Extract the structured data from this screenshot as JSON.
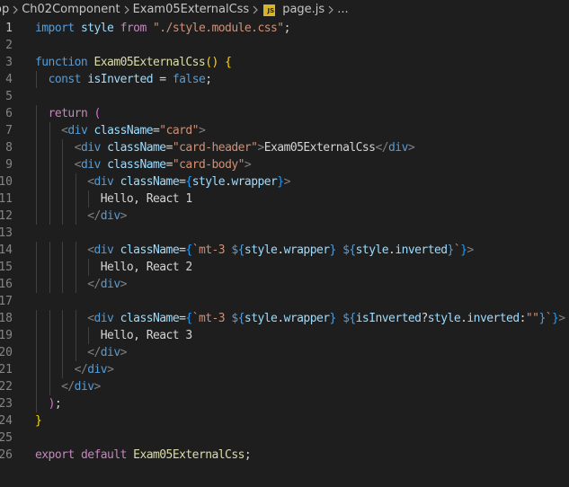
{
  "breadcrumb": {
    "items": [
      "op",
      "Ch02Component",
      "Exam05ExternalCss",
      "page.js",
      "..."
    ],
    "file_icon_label": "JS"
  },
  "editor": {
    "active_line": 1,
    "lines": [
      {
        "n": "1",
        "tokens": [
          [
            "kw",
            "import"
          ],
          [
            "plain",
            " "
          ],
          [
            "var",
            "style"
          ],
          [
            "plain",
            " "
          ],
          [
            "ctl",
            "from"
          ],
          [
            "plain",
            " "
          ],
          [
            "str",
            "\"./style.module.css\""
          ],
          [
            "plain",
            ";"
          ]
        ]
      },
      {
        "n": "2",
        "tokens": []
      },
      {
        "n": "3",
        "tokens": [
          [
            "kw",
            "function"
          ],
          [
            "plain",
            " "
          ],
          [
            "fn",
            "Exam05ExternalCss"
          ],
          [
            "br1",
            "()"
          ],
          [
            "plain",
            " "
          ],
          [
            "br1",
            "{"
          ]
        ]
      },
      {
        "n": "4",
        "tokens": [
          [
            "plain",
            "  "
          ],
          [
            "kw",
            "const"
          ],
          [
            "plain",
            " "
          ],
          [
            "var",
            "isInverted"
          ],
          [
            "plain",
            " = "
          ],
          [
            "kw",
            "false"
          ],
          [
            "plain",
            ";"
          ]
        ]
      },
      {
        "n": "5",
        "tokens": []
      },
      {
        "n": "6",
        "tokens": [
          [
            "plain",
            "  "
          ],
          [
            "ctl",
            "return"
          ],
          [
            "plain",
            " "
          ],
          [
            "br2",
            "("
          ]
        ]
      },
      {
        "n": "7",
        "tokens": [
          [
            "plain",
            "    "
          ],
          [
            "brk",
            "<"
          ],
          [
            "tag",
            "div"
          ],
          [
            "plain",
            " "
          ],
          [
            "var",
            "className"
          ],
          [
            "plain",
            "="
          ],
          [
            "str",
            "\"card\""
          ],
          [
            "brk",
            ">"
          ]
        ]
      },
      {
        "n": "8",
        "tokens": [
          [
            "plain",
            "      "
          ],
          [
            "brk",
            "<"
          ],
          [
            "tag",
            "div"
          ],
          [
            "plain",
            " "
          ],
          [
            "var",
            "className"
          ],
          [
            "plain",
            "="
          ],
          [
            "str",
            "\"card-header\""
          ],
          [
            "brk",
            ">"
          ],
          [
            "plain",
            "Exam05ExternalCss"
          ],
          [
            "brk",
            "</"
          ],
          [
            "tag",
            "div"
          ],
          [
            "brk",
            ">"
          ]
        ]
      },
      {
        "n": "9",
        "tokens": [
          [
            "plain",
            "      "
          ],
          [
            "brk",
            "<"
          ],
          [
            "tag",
            "div"
          ],
          [
            "plain",
            " "
          ],
          [
            "var",
            "className"
          ],
          [
            "plain",
            "="
          ],
          [
            "str",
            "\"card-body\""
          ],
          [
            "brk",
            ">"
          ]
        ]
      },
      {
        "n": "10",
        "tokens": [
          [
            "plain",
            "        "
          ],
          [
            "brk",
            "<"
          ],
          [
            "tag",
            "div"
          ],
          [
            "plain",
            " "
          ],
          [
            "var",
            "className"
          ],
          [
            "plain",
            "="
          ],
          [
            "br3",
            "{"
          ],
          [
            "var",
            "style"
          ],
          [
            "plain",
            "."
          ],
          [
            "var",
            "wrapper"
          ],
          [
            "br3",
            "}"
          ],
          [
            "brk",
            ">"
          ]
        ]
      },
      {
        "n": "11",
        "tokens": [
          [
            "plain",
            "          Hello, React 1"
          ]
        ]
      },
      {
        "n": "12",
        "tokens": [
          [
            "plain",
            "        "
          ],
          [
            "brk",
            "</"
          ],
          [
            "tag",
            "div"
          ],
          [
            "brk",
            ">"
          ]
        ]
      },
      {
        "n": "13",
        "tokens": []
      },
      {
        "n": "14",
        "tokens": [
          [
            "plain",
            "        "
          ],
          [
            "brk",
            "<"
          ],
          [
            "tag",
            "div"
          ],
          [
            "plain",
            " "
          ],
          [
            "var",
            "className"
          ],
          [
            "plain",
            "="
          ],
          [
            "br3",
            "{"
          ],
          [
            "str",
            "`mt-3 "
          ],
          [
            "kw",
            "${"
          ],
          [
            "var",
            "style"
          ],
          [
            "plain",
            "."
          ],
          [
            "var",
            "wrapper"
          ],
          [
            "kw",
            "}"
          ],
          [
            "str",
            " "
          ],
          [
            "kw",
            "${"
          ],
          [
            "var",
            "style"
          ],
          [
            "plain",
            "."
          ],
          [
            "var",
            "inverted"
          ],
          [
            "kw",
            "}"
          ],
          [
            "str",
            "`"
          ],
          [
            "br3",
            "}"
          ],
          [
            "brk",
            ">"
          ]
        ]
      },
      {
        "n": "15",
        "tokens": [
          [
            "plain",
            "          Hello, React 2"
          ]
        ]
      },
      {
        "n": "16",
        "tokens": [
          [
            "plain",
            "        "
          ],
          [
            "brk",
            "</"
          ],
          [
            "tag",
            "div"
          ],
          [
            "brk",
            ">"
          ]
        ]
      },
      {
        "n": "17",
        "tokens": []
      },
      {
        "n": "18",
        "tokens": [
          [
            "plain",
            "        "
          ],
          [
            "brk",
            "<"
          ],
          [
            "tag",
            "div"
          ],
          [
            "plain",
            " "
          ],
          [
            "var",
            "className"
          ],
          [
            "plain",
            "="
          ],
          [
            "br3",
            "{"
          ],
          [
            "str",
            "`mt-3 "
          ],
          [
            "kw",
            "${"
          ],
          [
            "var",
            "style"
          ],
          [
            "plain",
            "."
          ],
          [
            "var",
            "wrapper"
          ],
          [
            "kw",
            "}"
          ],
          [
            "str",
            " "
          ],
          [
            "kw",
            "${"
          ],
          [
            "var",
            "isInverted"
          ],
          [
            "plain",
            "?"
          ],
          [
            "var",
            "style"
          ],
          [
            "plain",
            "."
          ],
          [
            "var",
            "inverted"
          ],
          [
            "plain",
            ":"
          ],
          [
            "str",
            "\"\""
          ],
          [
            "kw",
            "}"
          ],
          [
            "str",
            "`"
          ],
          [
            "br3",
            "}"
          ],
          [
            "brk",
            ">"
          ]
        ]
      },
      {
        "n": "19",
        "tokens": [
          [
            "plain",
            "          Hello, React 3"
          ]
        ]
      },
      {
        "n": "20",
        "tokens": [
          [
            "plain",
            "        "
          ],
          [
            "brk",
            "</"
          ],
          [
            "tag",
            "div"
          ],
          [
            "brk",
            ">"
          ]
        ]
      },
      {
        "n": "21",
        "tokens": [
          [
            "plain",
            "      "
          ],
          [
            "brk",
            "</"
          ],
          [
            "tag",
            "div"
          ],
          [
            "brk",
            ">"
          ]
        ]
      },
      {
        "n": "22",
        "tokens": [
          [
            "plain",
            "    "
          ],
          [
            "brk",
            "</"
          ],
          [
            "tag",
            "div"
          ],
          [
            "brk",
            ">"
          ]
        ]
      },
      {
        "n": "23",
        "tokens": [
          [
            "plain",
            "  "
          ],
          [
            "br2",
            ")"
          ],
          [
            "plain",
            ";"
          ]
        ]
      },
      {
        "n": "24",
        "tokens": [
          [
            "br1",
            "}"
          ]
        ]
      },
      {
        "n": "25",
        "tokens": []
      },
      {
        "n": "26",
        "tokens": [
          [
            "ctl",
            "export"
          ],
          [
            "plain",
            " "
          ],
          [
            "ctl",
            "default"
          ],
          [
            "plain",
            " "
          ],
          [
            "fn",
            "Exam05ExternalCss"
          ],
          [
            "plain",
            ";"
          ]
        ]
      }
    ]
  },
  "colors": {
    "background": "#1e1e1e",
    "keyword": "#569cd6",
    "control": "#c586c0",
    "function": "#dcdcaa",
    "variable": "#9cdcfe",
    "string": "#ce9178"
  }
}
